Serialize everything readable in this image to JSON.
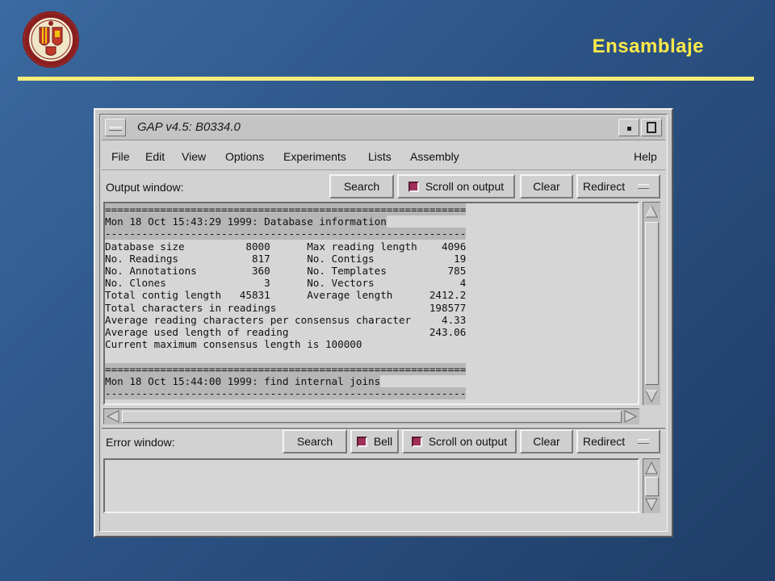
{
  "slide": {
    "title": "Ensamblaje"
  },
  "window": {
    "title": "GAP v4.5: B0334.0"
  },
  "menu": [
    "File",
    "Edit",
    "View",
    "Options",
    "Experiments",
    "Lists",
    "Assembly",
    "Help"
  ],
  "output": {
    "label": "Output window:",
    "search_label": "Search",
    "scroll_label": "Scroll on output",
    "clear_label": "Clear",
    "redirect_label": "Redirect",
    "lines": [
      "===========================================================",
      "Mon 18 Oct 15:43:29 1999: Database information",
      "-----------------------------------------------------------",
      "Database size          8000      Max reading length    4096",
      "No. Readings            817      No. Contigs             19",
      "No. Annotations         360      No. Templates          785",
      "No. Clones                3      No. Vectors              4",
      "Total contig length   45831      Average length      2412.2",
      "Total characters in readings                         198577",
      "Average reading characters per consensus character     4.33",
      "Average used length of reading                       243.06",
      "Current maximum consensus length is 100000",
      "",
      "===========================================================",
      "Mon 18 Oct 15:44:00 1999: find internal joins",
      "-----------------------------------------------------------"
    ]
  },
  "error": {
    "label": "Error window:",
    "search_label": "Search",
    "bell_label": "Bell",
    "scroll_label": "Scroll on output",
    "clear_label": "Clear",
    "redirect_label": "Redirect"
  },
  "colors": {
    "title_yellow": "#ffe94a",
    "indicator": "#a0305a",
    "background": "#2c5385"
  }
}
